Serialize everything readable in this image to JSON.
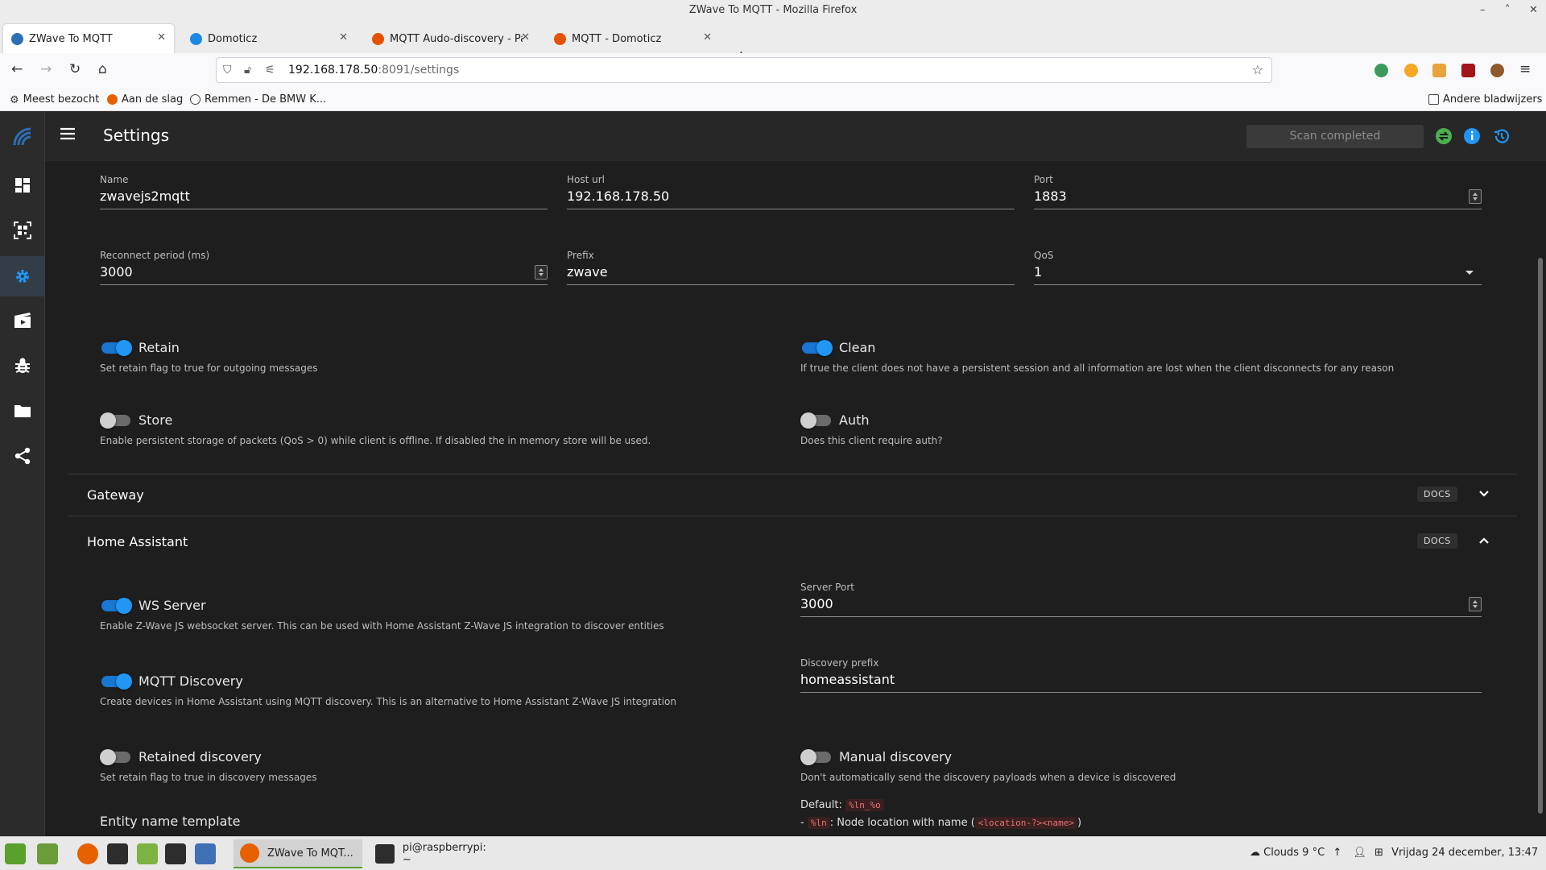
{
  "window": {
    "title": "ZWave To MQTT - Mozilla Firefox"
  },
  "tabs": [
    {
      "label": "ZWave To MQTT",
      "favicon_color": "#2d6fb4"
    },
    {
      "label": "Domoticz",
      "favicon_color": "#1e88e5"
    },
    {
      "label": "MQTT Audo-discovery - Pag",
      "favicon_color": "#e65100"
    },
    {
      "label": "MQTT - Domoticz",
      "favicon_color": "#e65100"
    }
  ],
  "url": {
    "host": "192.168.178.50",
    "rest": ":8091/settings"
  },
  "bookmarks": {
    "items": [
      "Meest bezocht",
      "Aan de slag",
      "Remmen - De BMW K..."
    ],
    "other": "Andere bladwijzers"
  },
  "app": {
    "title": "Settings",
    "status": "Scan completed",
    "colors": {
      "accent": "#2196f3",
      "status_ok": "#4caf50"
    }
  },
  "mqtt": {
    "name_label": "Name",
    "name_value": "zwavejs2mqtt",
    "host_label": "Host url",
    "host_value": "192.168.178.50",
    "port_label": "Port",
    "port_value": "1883",
    "reconnect_label": "Reconnect period (ms)",
    "reconnect_value": "3000",
    "prefix_label": "Prefix",
    "prefix_value": "zwave",
    "qos_label": "QoS",
    "qos_value": "1",
    "retain_label": "Retain",
    "retain_hint": "Set retain flag to true for outgoing messages",
    "clean_label": "Clean",
    "clean_hint": "If true the client does not have a persistent session and all information are lost when the client disconnects for any reason",
    "store_label": "Store",
    "store_hint": "Enable persistent storage of packets (QoS > 0) while client is offline. If disabled the in memory store will be used.",
    "auth_label": "Auth",
    "auth_hint": "Does this client require auth?"
  },
  "gateway": {
    "title": "Gateway",
    "docs": "DOCS"
  },
  "ha": {
    "title": "Home Assistant",
    "docs": "DOCS",
    "ws_label": "WS Server",
    "ws_hint": "Enable Z-Wave JS websocket server. This can be used with Home Assistant Z-Wave JS integration to discover entities",
    "server_port_label": "Server Port",
    "server_port_value": "3000",
    "mqtt_disc_label": "MQTT Discovery",
    "mqtt_disc_hint": "Create devices in Home Assistant using MQTT discovery. This is an alternative to Home Assistant Z-Wave JS integration",
    "disc_prefix_label": "Discovery prefix",
    "disc_prefix_value": "homeassistant",
    "retained_disc_label": "Retained discovery",
    "retained_disc_hint": "Set retain flag to true in discovery messages",
    "manual_disc_label": "Manual discovery",
    "manual_disc_hint": "Don't automatically send the discovery payloads when a device is discovered",
    "entity_tpl_label": "Entity name template",
    "default_label": "Default:",
    "default_code": "%ln_%o",
    "ln_prefix": "-",
    "ln_code": "%ln",
    "ln_text": ": Node location with name (",
    "ln_code2": "<location-?><name>",
    "ln_close": ")"
  },
  "taskbar": {
    "windows": [
      "ZWave To MQT...",
      "pi@raspberrypi: ~"
    ],
    "weather": "Clouds 9 °C",
    "clock": "Vrijdag 24 december, 13:47"
  }
}
